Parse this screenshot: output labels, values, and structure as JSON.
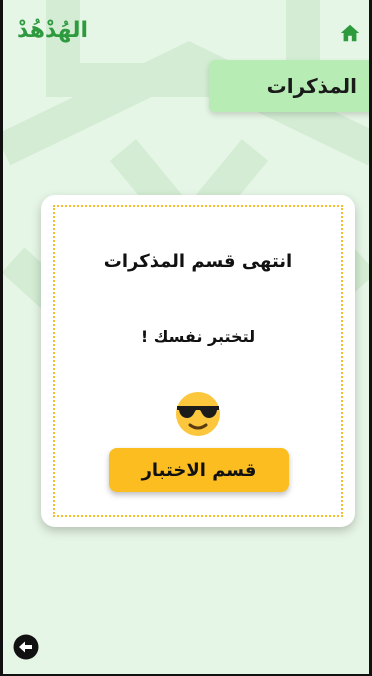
{
  "app": {
    "title": "الهُدْهُدْ",
    "home_icon": "home-icon",
    "back_icon": "back-arrow-icon"
  },
  "section": {
    "title": "المذكرات"
  },
  "card": {
    "message_line1": "انتهى قسم المذكرات",
    "message_line2": "لتختبر نفسك !",
    "emoji_icon": "sunglasses-face-icon",
    "button_label": "قسم الاختبار"
  },
  "colors": {
    "background": "#e6f6e6",
    "brand_green": "#2e9a3e",
    "header_green": "#b7edb4",
    "accent_yellow": "#fbbd1f"
  }
}
